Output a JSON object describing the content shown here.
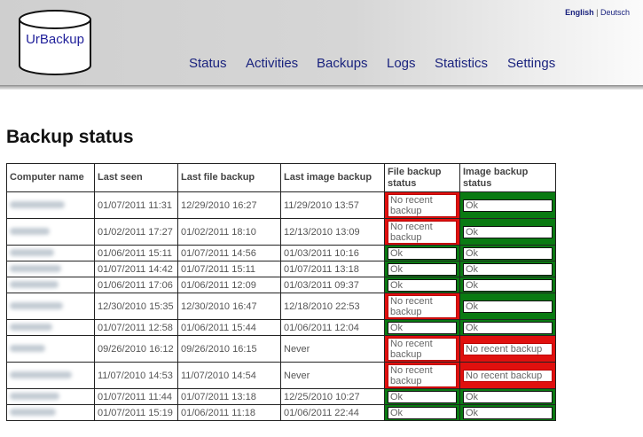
{
  "app": {
    "logo_text": "UrBackup",
    "languages": {
      "english": "English",
      "separator": "|",
      "deutsch": "Deutsch"
    }
  },
  "nav": [
    {
      "label": "Status",
      "active": true
    },
    {
      "label": "Activities",
      "active": false
    },
    {
      "label": "Backups",
      "active": false
    },
    {
      "label": "Logs",
      "active": false
    },
    {
      "label": "Statistics",
      "active": false
    },
    {
      "label": "Settings",
      "active": false
    }
  ],
  "page_title": "Backup status",
  "table": {
    "headers": [
      "Computer name",
      "Last seen",
      "Last file backup",
      "Last image backup",
      "File backup status",
      "Image backup status"
    ],
    "status_colors": {
      "ok": "#0a7a12",
      "bad": "#e0100e"
    },
    "rows": [
      {
        "last_seen": "01/07/2011 11:31",
        "last_file": "12/29/2010 16:27",
        "last_image": "11/29/2010 13:57",
        "file_status": "No recent backup",
        "file_ok": false,
        "image_status": "Ok",
        "image_ok": true
      },
      {
        "last_seen": "01/02/2011 17:27",
        "last_file": "01/02/2011 18:10",
        "last_image": "12/13/2010 13:09",
        "file_status": "No recent backup",
        "file_ok": false,
        "image_status": "Ok",
        "image_ok": true
      },
      {
        "last_seen": "01/06/2011 15:11",
        "last_file": "01/07/2011 14:56",
        "last_image": "01/03/2011 10:16",
        "file_status": "Ok",
        "file_ok": true,
        "image_status": "Ok",
        "image_ok": true
      },
      {
        "last_seen": "01/07/2011 14:42",
        "last_file": "01/07/2011 15:11",
        "last_image": "01/07/2011 13:18",
        "file_status": "Ok",
        "file_ok": true,
        "image_status": "Ok",
        "image_ok": true
      },
      {
        "last_seen": "01/06/2011 17:06",
        "last_file": "01/06/2011 12:09",
        "last_image": "01/03/2011 09:37",
        "file_status": "Ok",
        "file_ok": true,
        "image_status": "Ok",
        "image_ok": true
      },
      {
        "last_seen": "12/30/2010 15:35",
        "last_file": "12/30/2010 16:47",
        "last_image": "12/18/2010 22:53",
        "file_status": "No recent backup",
        "file_ok": false,
        "image_status": "Ok",
        "image_ok": true
      },
      {
        "last_seen": "01/07/2011 12:58",
        "last_file": "01/06/2011 15:44",
        "last_image": "01/06/2011 12:04",
        "file_status": "Ok",
        "file_ok": true,
        "image_status": "Ok",
        "image_ok": true
      },
      {
        "last_seen": "09/26/2010 16:12",
        "last_file": "09/26/2010 16:15",
        "last_image": "Never",
        "file_status": "No recent backup",
        "file_ok": false,
        "image_status": "No recent backup",
        "image_ok": false
      },
      {
        "last_seen": "11/07/2010 14:53",
        "last_file": "11/07/2010 14:54",
        "last_image": "Never",
        "file_status": "No recent backup",
        "file_ok": false,
        "image_status": "No recent backup",
        "image_ok": false
      },
      {
        "last_seen": "01/07/2011 11:44",
        "last_file": "01/07/2011 13:18",
        "last_image": "12/25/2010 10:27",
        "file_status": "Ok",
        "file_ok": true,
        "image_status": "Ok",
        "image_ok": true
      },
      {
        "last_seen": "01/07/2011 15:19",
        "last_file": "01/06/2011 11:18",
        "last_image": "01/06/2011 22:44",
        "file_status": "Ok",
        "file_ok": true,
        "image_status": "Ok",
        "image_ok": true
      }
    ]
  }
}
